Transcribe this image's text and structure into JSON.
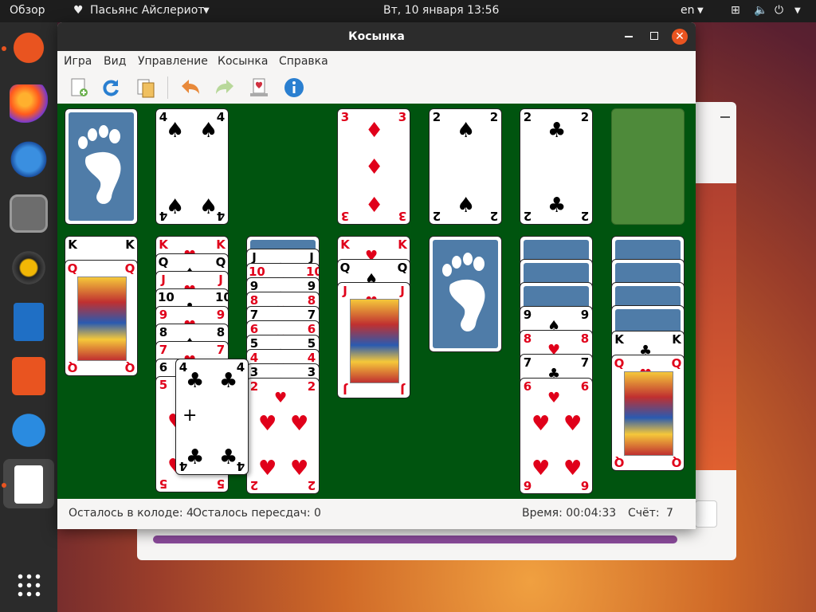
{
  "topbar": {
    "overview": "Обзор",
    "app_name": "Пасьянс Айслериот",
    "clock": "Вт, 10 января  13:56",
    "lang": "en"
  },
  "window": {
    "title": "Косынка"
  },
  "menu": [
    "Игра",
    "Вид",
    "Управление",
    "Косынка",
    "Справка"
  ],
  "toolbar": [
    "new-game-icon",
    "restart-icon",
    "select-game-icon",
    "undo-icon",
    "redo-icon",
    "hint-icon",
    "info-icon"
  ],
  "status": {
    "deck_left": "Осталось в колоде: 4",
    "redeals_left": "Осталось пересдач: 0",
    "time": "Время: 00:04:33",
    "score_label": "Счёт:",
    "score_value": "7"
  },
  "cards": {
    "waste_top": {
      "rank": "4",
      "suit": "♠"
    },
    "f1": {
      "rank": "3",
      "suit": "♦"
    },
    "f2": {
      "rank": "2",
      "suit": "♠"
    },
    "f3": {
      "rank": "2",
      "suit": "♣"
    },
    "dragged": {
      "rank": "4",
      "suit": "♣"
    },
    "col1_top": {
      "rank": "Q",
      "suit": "♦"
    },
    "col1_under": {
      "rank": "K",
      "suit": "♠"
    },
    "col2": [
      {
        "rank": "K",
        "suit": "♥"
      },
      {
        "rank": "Q",
        "suit": "♠"
      },
      {
        "rank": "J",
        "suit": "♥"
      },
      {
        "rank": "10",
        "suit": "♣"
      },
      {
        "rank": "9",
        "suit": "♥"
      },
      {
        "rank": "8",
        "suit": "♠"
      },
      {
        "rank": "7",
        "suit": "♥"
      },
      {
        "rank": "6",
        "suit": "♣"
      },
      {
        "rank": "5",
        "suit": "♥"
      }
    ],
    "col3": [
      {
        "rank": "J",
        "suit": "♣"
      },
      {
        "rank": "10",
        "suit": "♥"
      },
      {
        "rank": "9",
        "suit": "♣"
      },
      {
        "rank": "8",
        "suit": "♥"
      },
      {
        "rank": "7",
        "suit": "♠"
      },
      {
        "rank": "6",
        "suit": "♥"
      },
      {
        "rank": "5",
        "suit": "♣"
      },
      {
        "rank": "4",
        "suit": "♥"
      },
      {
        "rank": "3",
        "suit": "♠"
      },
      {
        "rank": "2",
        "suit": "♥"
      }
    ],
    "col4": [
      {
        "rank": "K",
        "suit": "♥"
      },
      {
        "rank": "Q",
        "suit": "♠"
      },
      {
        "rank": "J",
        "suit": "♥"
      }
    ],
    "col6": [
      {
        "rank": "9",
        "suit": "♠"
      },
      {
        "rank": "8",
        "suit": "♥"
      },
      {
        "rank": "7",
        "suit": "♣"
      },
      {
        "rank": "6",
        "suit": "♥"
      }
    ],
    "col7": [
      {
        "rank": "K",
        "suit": "♣"
      },
      {
        "rank": "Q",
        "suit": "♥"
      }
    ]
  },
  "colors": {
    "felt": "#00540f",
    "card_back": "#4f7ca8",
    "red_suit": "#e0001a",
    "accent": "#e95420"
  }
}
